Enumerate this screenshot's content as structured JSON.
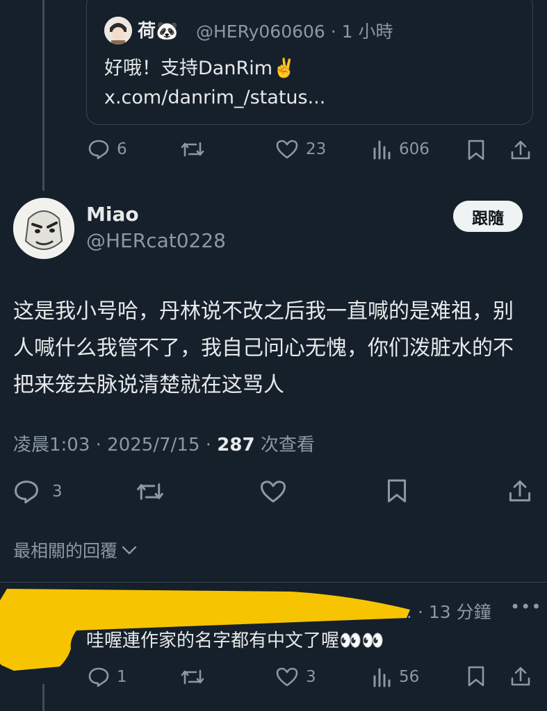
{
  "quoted": {
    "name": "荷",
    "name_emoji": "🐼",
    "handle_time": "@HERy060606 · 1 小時",
    "text": "好哦！支持DanRim✌️ x.com/danrim_/status..."
  },
  "quoted_actions": {
    "replies": "6",
    "likes": "23",
    "views": "606"
  },
  "post": {
    "name": "Miao",
    "handle": "@HERcat0228",
    "follow_label": "跟隨",
    "text": "这是我小号哈，丹林说不改之后我一直喊的是难祖，别人喊什么我管不了，我自己问心无愧，你们泼脏水的不把来笼去脉说清楚就在这骂人",
    "time_date": "凌晨1:03 · 2025/7/15 · ",
    "views": "287",
    "views_label": " 次查看"
  },
  "post_actions": {
    "replies": "3"
  },
  "relevant_label": "最相關的回覆",
  "reply": {
    "time": "… · 13 分鐘",
    "more": "•••",
    "text": "哇喔連作家的名字都有中文了喔👀👀"
  },
  "reply_actions": {
    "replies": "1",
    "likes": "3",
    "views": "56"
  },
  "colors": {
    "background": "#15202b",
    "text": "#e7e9ea",
    "muted": "#8b98a5",
    "border": "#38444d",
    "highlight": "#f6c400"
  }
}
